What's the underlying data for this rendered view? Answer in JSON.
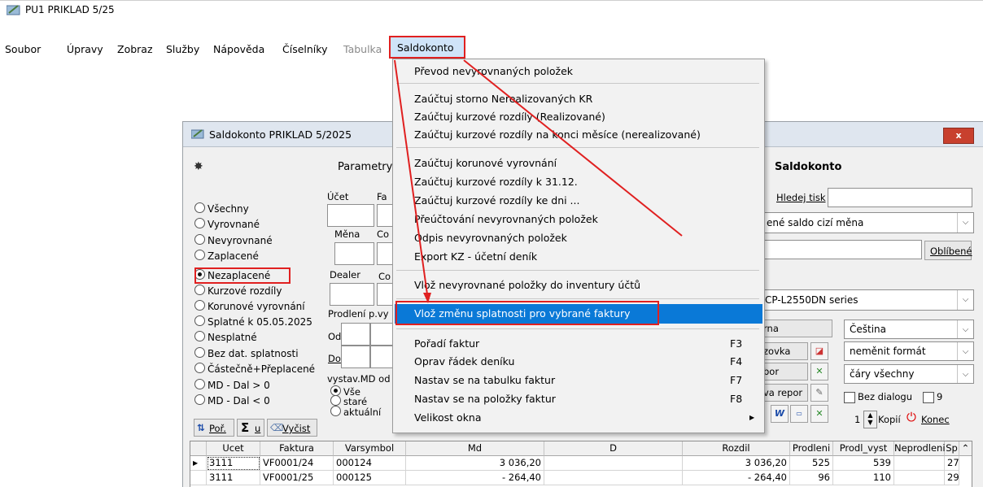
{
  "app": {
    "title": "PU1 PRIKLAD 5/25"
  },
  "menubar": [
    "Soubor",
    "Úpravy",
    "Zobraz",
    "Služby",
    "Nápověda",
    "Číselníky",
    "Tabulka",
    "Saldokonto"
  ],
  "child": {
    "title": "Saldokonto  PRIKLAD  5/2025",
    "close": "x",
    "parametry": "Parametry",
    "radios": [
      "Všechny",
      "Vyrovnané",
      "Nevyrovnané",
      "Zaplacené",
      "Nezaplacené",
      "Kurzové rozdíly",
      "Korunové vyrovnání",
      "Splatné k 05.05.2025",
      "Nesplatné",
      "Bez dat. splatnosti",
      "Částečně+Přeplacené",
      "MD - Dal > 0",
      "MD - Dal < 0"
    ],
    "labels": {
      "ucet": "Účet",
      "fa": "Fa",
      "mena": "Měna",
      "co1": "Co",
      "dealer": "Dealer",
      "co2": "Co",
      "prodleni": "Prodlení p.vy",
      "od": "Od",
      "do": "Do",
      "vystav": "vystav.MD od"
    },
    "vystav_radios": [
      "Vše",
      "staré",
      "aktuální"
    ],
    "buttons": {
      "por": "Poř.",
      "sum": "u",
      "vycist": "Vyčist"
    },
    "right": {
      "title": "Saldokonto",
      "hledej": "Hledej tisk",
      "combo": "ené saldo cizí měna",
      "oblibene": "Oblíbené",
      "printer": "CP-L2550DN series",
      "left_buttons": [
        "rna",
        "zovka",
        "bor",
        "va repor"
      ],
      "lang": "Čeština",
      "format": "neměnit formát",
      "lines": "čáry všechny",
      "bez_dialogu": "Bez dialogu",
      "nine": "9",
      "kopii_value": "1",
      "kopii": "Kopií",
      "konec": "Konec"
    }
  },
  "grid": {
    "headers": [
      "Ucet",
      "Faktura",
      "Varsymbol",
      "Md",
      "D",
      "Rozdil",
      "Prodleni",
      "Prodl_vyst",
      "Neprodleni",
      "Sp"
    ],
    "rows": [
      [
        "3111",
        "VF0001/24",
        "000124",
        "3 036,20",
        "",
        "3 036,20",
        "525",
        "539",
        "",
        "27"
      ],
      [
        "3111",
        "VF0001/25",
        "000125",
        "- 264,40",
        "",
        "- 264,40",
        "96",
        "110",
        "",
        "29"
      ]
    ]
  },
  "dropdown": {
    "items": [
      {
        "label": "Převod nevyrovnaných položek",
        "shortcut": ""
      },
      {
        "label": "Zaúčtuj storno Nerealizovaných KR",
        "shortcut": ""
      },
      {
        "label": "Zaúčtuj kurzové rozdíly (Realizované)",
        "shortcut": ""
      },
      {
        "label": "Zaúčtuj kurzové rozdíly na konci měsíce (nerealizované)",
        "shortcut": ""
      },
      {
        "label": "Zaúčtuj korunové vyrovnání",
        "shortcut": ""
      },
      {
        "label": "Zaúčtuj kurzové rozdíly k 31.12.",
        "shortcut": ""
      },
      {
        "label": "Zaúčtuj kurzové rozdíly ke dni ...",
        "shortcut": ""
      },
      {
        "label": "Přeúčtování nevyrovnaných položek",
        "shortcut": ""
      },
      {
        "label": "Odpis nevyrovnaných položek",
        "shortcut": ""
      },
      {
        "label": "Export KZ - účetní deník",
        "shortcut": ""
      },
      {
        "label": "Vlož nevyrovnané položky do inventury účtů",
        "shortcut": ""
      },
      {
        "label": "Vlož změnu splatnosti pro vybrané faktury",
        "shortcut": ""
      },
      {
        "label": "Pořadí faktur",
        "shortcut": "F3"
      },
      {
        "label": "Oprav řádek deníku",
        "shortcut": "F4"
      },
      {
        "label": "Nastav se na tabulku faktur",
        "shortcut": "F7"
      },
      {
        "label": "Nastav se na položky faktur",
        "shortcut": "F8"
      },
      {
        "label": "Velikost okna",
        "shortcut": ""
      }
    ]
  },
  "colors": {
    "highlight": "#0a79d7",
    "annotation": "#e02020",
    "menu_bg": "#f2f2f2"
  }
}
